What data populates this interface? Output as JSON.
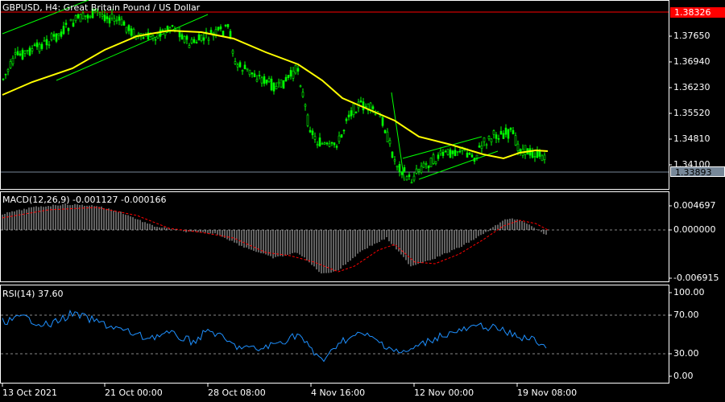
{
  "window": {
    "symbol_title": "GBPUSD, H4:  Great Britain Pound / US Dollar"
  },
  "price_axis": {
    "ticks": [
      "1.37650",
      "1.36940",
      "1.36230",
      "1.35520",
      "1.34810",
      "1.34100"
    ],
    "ylim": [
      1.334,
      1.3836
    ]
  },
  "price_tags": {
    "high_line": "1.38326",
    "current": "1.33893"
  },
  "macd": {
    "title": "MACD(12,26,9) -0.001127 -0.000166",
    "ticks": [
      "0.004697",
      "0.000000",
      "-0.006915"
    ]
  },
  "rsi": {
    "title": "RSI(14) 37.60",
    "ticks": [
      "100.00",
      "70.00",
      "30.00",
      "0.00"
    ],
    "levels": [
      70,
      30
    ]
  },
  "time_axis": {
    "labels": [
      "13 Oct 2021",
      "21 Oct 00:00",
      "28 Oct 08:00",
      "4 Nov 16:00",
      "12 Nov 00:00",
      "19 Nov 08:00"
    ]
  },
  "colors": {
    "background": "#000000",
    "candles": "#00ff00",
    "moving_average": "#ffff00",
    "high_line": "#ff0000",
    "current_price_line": "#778899",
    "macd_histogram": "#c0c0c0",
    "macd_signal": "#ff0000",
    "rsi_line": "#1e90ff",
    "axis": "#ffffff"
  },
  "chart_data": {
    "type": "line",
    "x": [
      "13 Oct 2021",
      "21 Oct 00:00",
      "28 Oct 08:00",
      "4 Nov 16:00",
      "12 Nov 00:00",
      "19 Nov 08:00"
    ],
    "series": [
      {
        "name": "GBPUSD",
        "values": [
          1.36,
          1.382,
          1.376,
          1.352,
          1.338,
          1.344
        ]
      }
    ],
    "ylim": [
      1.334,
      1.3836
    ]
  }
}
